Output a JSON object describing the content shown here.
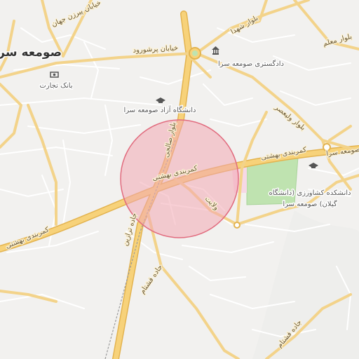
{
  "map": {
    "city_label": "صومعه سرا",
    "colors": {
      "background": "#f2f1ef",
      "major_road": "#f7d27a",
      "major_road_casing": "#e3b34f",
      "minor_road": "#ffffff",
      "park": "#bfe3b0",
      "circle_fill": "#f3a7b2",
      "circle_stroke": "#e16b7e"
    },
    "pois": {
      "university_azad": "دانشگاه آزاد صومعه سرا",
      "court": "دادگستری صومعه سرا",
      "bank": "بانک تجارت",
      "agri_line1": "دانشکده کشاورزی (دانشگاه",
      "agri_line2": "گیلان) صومعه سرا"
    },
    "roads": {
      "beheshti_center": "کمربندی بهشتی",
      "beheshti_east": "کمربندی بهشتی",
      "beheshti_west": "کمربندی بهشتی",
      "saleh": "بلوار صالحی",
      "valiasr": "بلوار ولیعصر",
      "shohada": "بلوار شهدا",
      "moallem": "بلوار معلم",
      "pourshoud": "خیابان پرشورود",
      "velayat": "ولایت",
      "fashtam": "جاده فشتام",
      "taher": "جاده ترازین",
      "north1": "خیابان پیرزن جهان",
      "east_sara": "صومعه سرا",
      "south_fashtam": "جاده فشتام"
    }
  }
}
